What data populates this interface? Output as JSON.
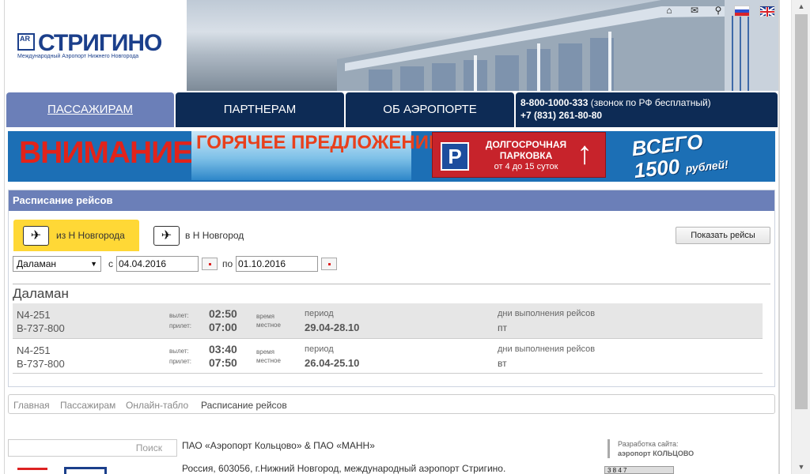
{
  "header": {
    "logo_ar": "AR",
    "logo_name": "СТРИГИНО",
    "logo_sub": "Международный Аэропорт Нижнего Новгорода",
    "icons": [
      "home-icon",
      "mail-icon",
      "sitemap-icon",
      "flag-ru-icon",
      "flag-uk-icon"
    ]
  },
  "nav": {
    "tabs": [
      {
        "label": "ПАССАЖИРАМ",
        "active": true
      },
      {
        "label": "ПАРТНЕРАМ",
        "active": false
      },
      {
        "label": "ОБ АЭРОПОРТЕ",
        "active": false
      }
    ],
    "phone1_number": "8-800-1000-333",
    "phone1_note": "(звонок по РФ бесплатный)",
    "phone2": "+7 (831) 261-80-80"
  },
  "banner": {
    "attention": "ВНИМАНИЕ!",
    "hot_offer": "ГОРЯЧЕЕ ПРЕДЛОЖЕНИЕ",
    "parking_p": "P",
    "parking_title": "ДОЛГОСРОЧНАЯ ПАРКОВКА",
    "parking_sub": "от 4 до 15 суток",
    "price_top": "ВСЕГО",
    "price_value": "1500",
    "price_unit": "рублей!",
    "colors": {
      "background": "#1c6fb5",
      "attention": "#e2231a",
      "parking": "#c7232b"
    }
  },
  "schedule": {
    "title": "Расписание рейсов",
    "tabs": [
      {
        "label": "из Н Новгорода",
        "active": true,
        "icon": "plane-departure-icon"
      },
      {
        "label": "в Н Новгород",
        "active": false,
        "icon": "plane-arrival-icon"
      }
    ],
    "show_button": "Показать рейсы",
    "destination": "Даламан",
    "from_label": "с",
    "date_from": "04.04.2016",
    "to_label": "по",
    "date_to": "01.10.2016",
    "dest_title": "Даламан",
    "labels": {
      "departure": "вылет:",
      "arrival": "прилет:",
      "time_top": "время",
      "time_bottom": "местное",
      "period": "период",
      "days": "дни выполнения рейсов"
    },
    "flights": [
      {
        "code": "N4-251",
        "aircraft": "B-737-800",
        "dep": "02:50",
        "arr": "07:00",
        "period": "29.04-28.10",
        "days": "пт"
      },
      {
        "code": "N4-251",
        "aircraft": "B-737-800",
        "dep": "03:40",
        "arr": "07:50",
        "period": "26.04-25.10",
        "days": "вт"
      }
    ]
  },
  "breadcrumbs": [
    "Главная",
    "Пассажирам",
    "Онлайн-табло",
    "Расписание рейсов"
  ],
  "footer": {
    "search_placeholder": "Поиск",
    "company": "ПАО «Аэропорт Кольцово» & ПАО «МАНН»",
    "address": "Россия, 603056, г.Нижний Новгород, международный аэропорт Стригино.",
    "dev_label": "Разработка сайта:",
    "dev_name": "аэропорт КОЛЬЦОВО",
    "counter": "3 8 4 7"
  },
  "colors": {
    "nav": "#0d2b55",
    "nav_active": "#6b7fb8",
    "tab_active": "#ffd836",
    "brand": "#1b3f8b"
  }
}
